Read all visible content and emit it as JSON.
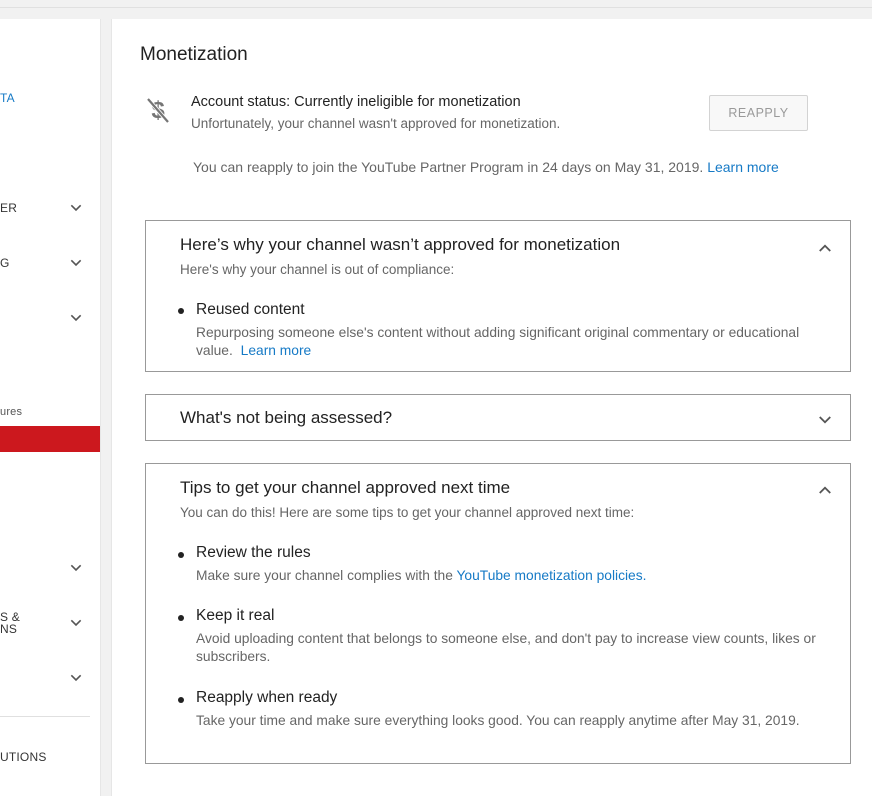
{
  "sidebar": {
    "items": [
      {
        "label": "TA",
        "style": "blue"
      },
      {
        "label": "ER",
        "chevron": true
      },
      {
        "label": "G",
        "chevron": true
      },
      {
        "label": "",
        "chevron": true
      },
      {
        "label": "ures",
        "style": "small"
      },
      {
        "label": "",
        "chevron": true
      },
      {
        "label": "S &",
        "chevron": true
      },
      {
        "label": "NS"
      },
      {
        "label": "",
        "chevron": true
      },
      {
        "label": "UTIONS"
      }
    ]
  },
  "main": {
    "title": "Monetization",
    "account_status": {
      "icon": "no-dollar-icon",
      "title": "Account status: Currently ineligible for monetization",
      "subtitle": "Unfortunately, your channel wasn't approved for monetization.",
      "button_label": "REAPPLY"
    },
    "reapply_note": {
      "text": "You can reapply to join the YouTube Partner Program in 24 days on May 31, 2019.",
      "link": "Learn more"
    },
    "cards": [
      {
        "title": "Here’s why your channel wasn’t approved for monetization",
        "subtitle": "Here's why your channel is out of compliance:",
        "expanded": true,
        "items": [
          {
            "title": "Reused content",
            "desc_line1": "Repurposing someone else's content without adding significant original commentary or educational",
            "desc_line2": "value.",
            "link": "Learn more"
          }
        ]
      },
      {
        "title": "What's not being assessed?",
        "expanded": false
      },
      {
        "title": "Tips to get your channel approved next time",
        "subtitle": "You can do this! Here are some tips to get your channel approved next time:",
        "expanded": true,
        "items": [
          {
            "title": "Review the rules",
            "desc": "Make sure your channel complies with the",
            "link": "YouTube monetization policies",
            "desc_end": "."
          },
          {
            "title": "Keep it real",
            "desc": "Avoid uploading content that belongs to someone else, and don't pay to increase view counts, likes or subscribers."
          },
          {
            "title": "Reapply when ready",
            "desc": "Take your time and make sure everything looks good. You can reapply anytime after May 31, 2019."
          }
        ]
      }
    ]
  },
  "colors": {
    "link": "#167ac6",
    "active_nav": "#cc181e",
    "card_border": "#999999"
  }
}
